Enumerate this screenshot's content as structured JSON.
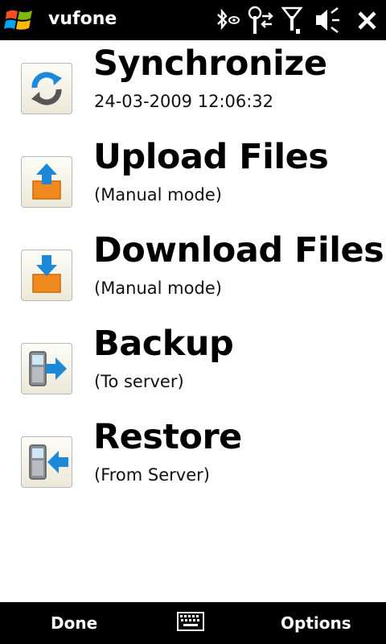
{
  "header": {
    "title": "vufone",
    "icons": [
      "windows-start-icon",
      "bluetooth-icon",
      "connectivity-icon",
      "signal-icon",
      "volume-icon",
      "close-icon"
    ]
  },
  "items": [
    {
      "title": "Synchronize",
      "subtitle": "24-03-2009 12:06:32",
      "icon": "synchronize-icon"
    },
    {
      "title": "Upload Files",
      "subtitle": "(Manual mode)",
      "icon": "upload-icon"
    },
    {
      "title": "Download Files",
      "subtitle": "(Manual mode)",
      "icon": "download-icon"
    },
    {
      "title": "Backup",
      "subtitle": "(To server)",
      "icon": "backup-phone-icon"
    },
    {
      "title": "Restore",
      "subtitle": "(From Server)",
      "icon": "restore-phone-icon"
    }
  ],
  "footer": {
    "left_softkey": "Done",
    "right_softkey": "Options",
    "center_icon": "keyboard-icon"
  },
  "colors": {
    "bar": "#000000",
    "accent_blue": "#1e88d8",
    "accent_orange": "#f08a1e",
    "background": "#ffffff"
  }
}
